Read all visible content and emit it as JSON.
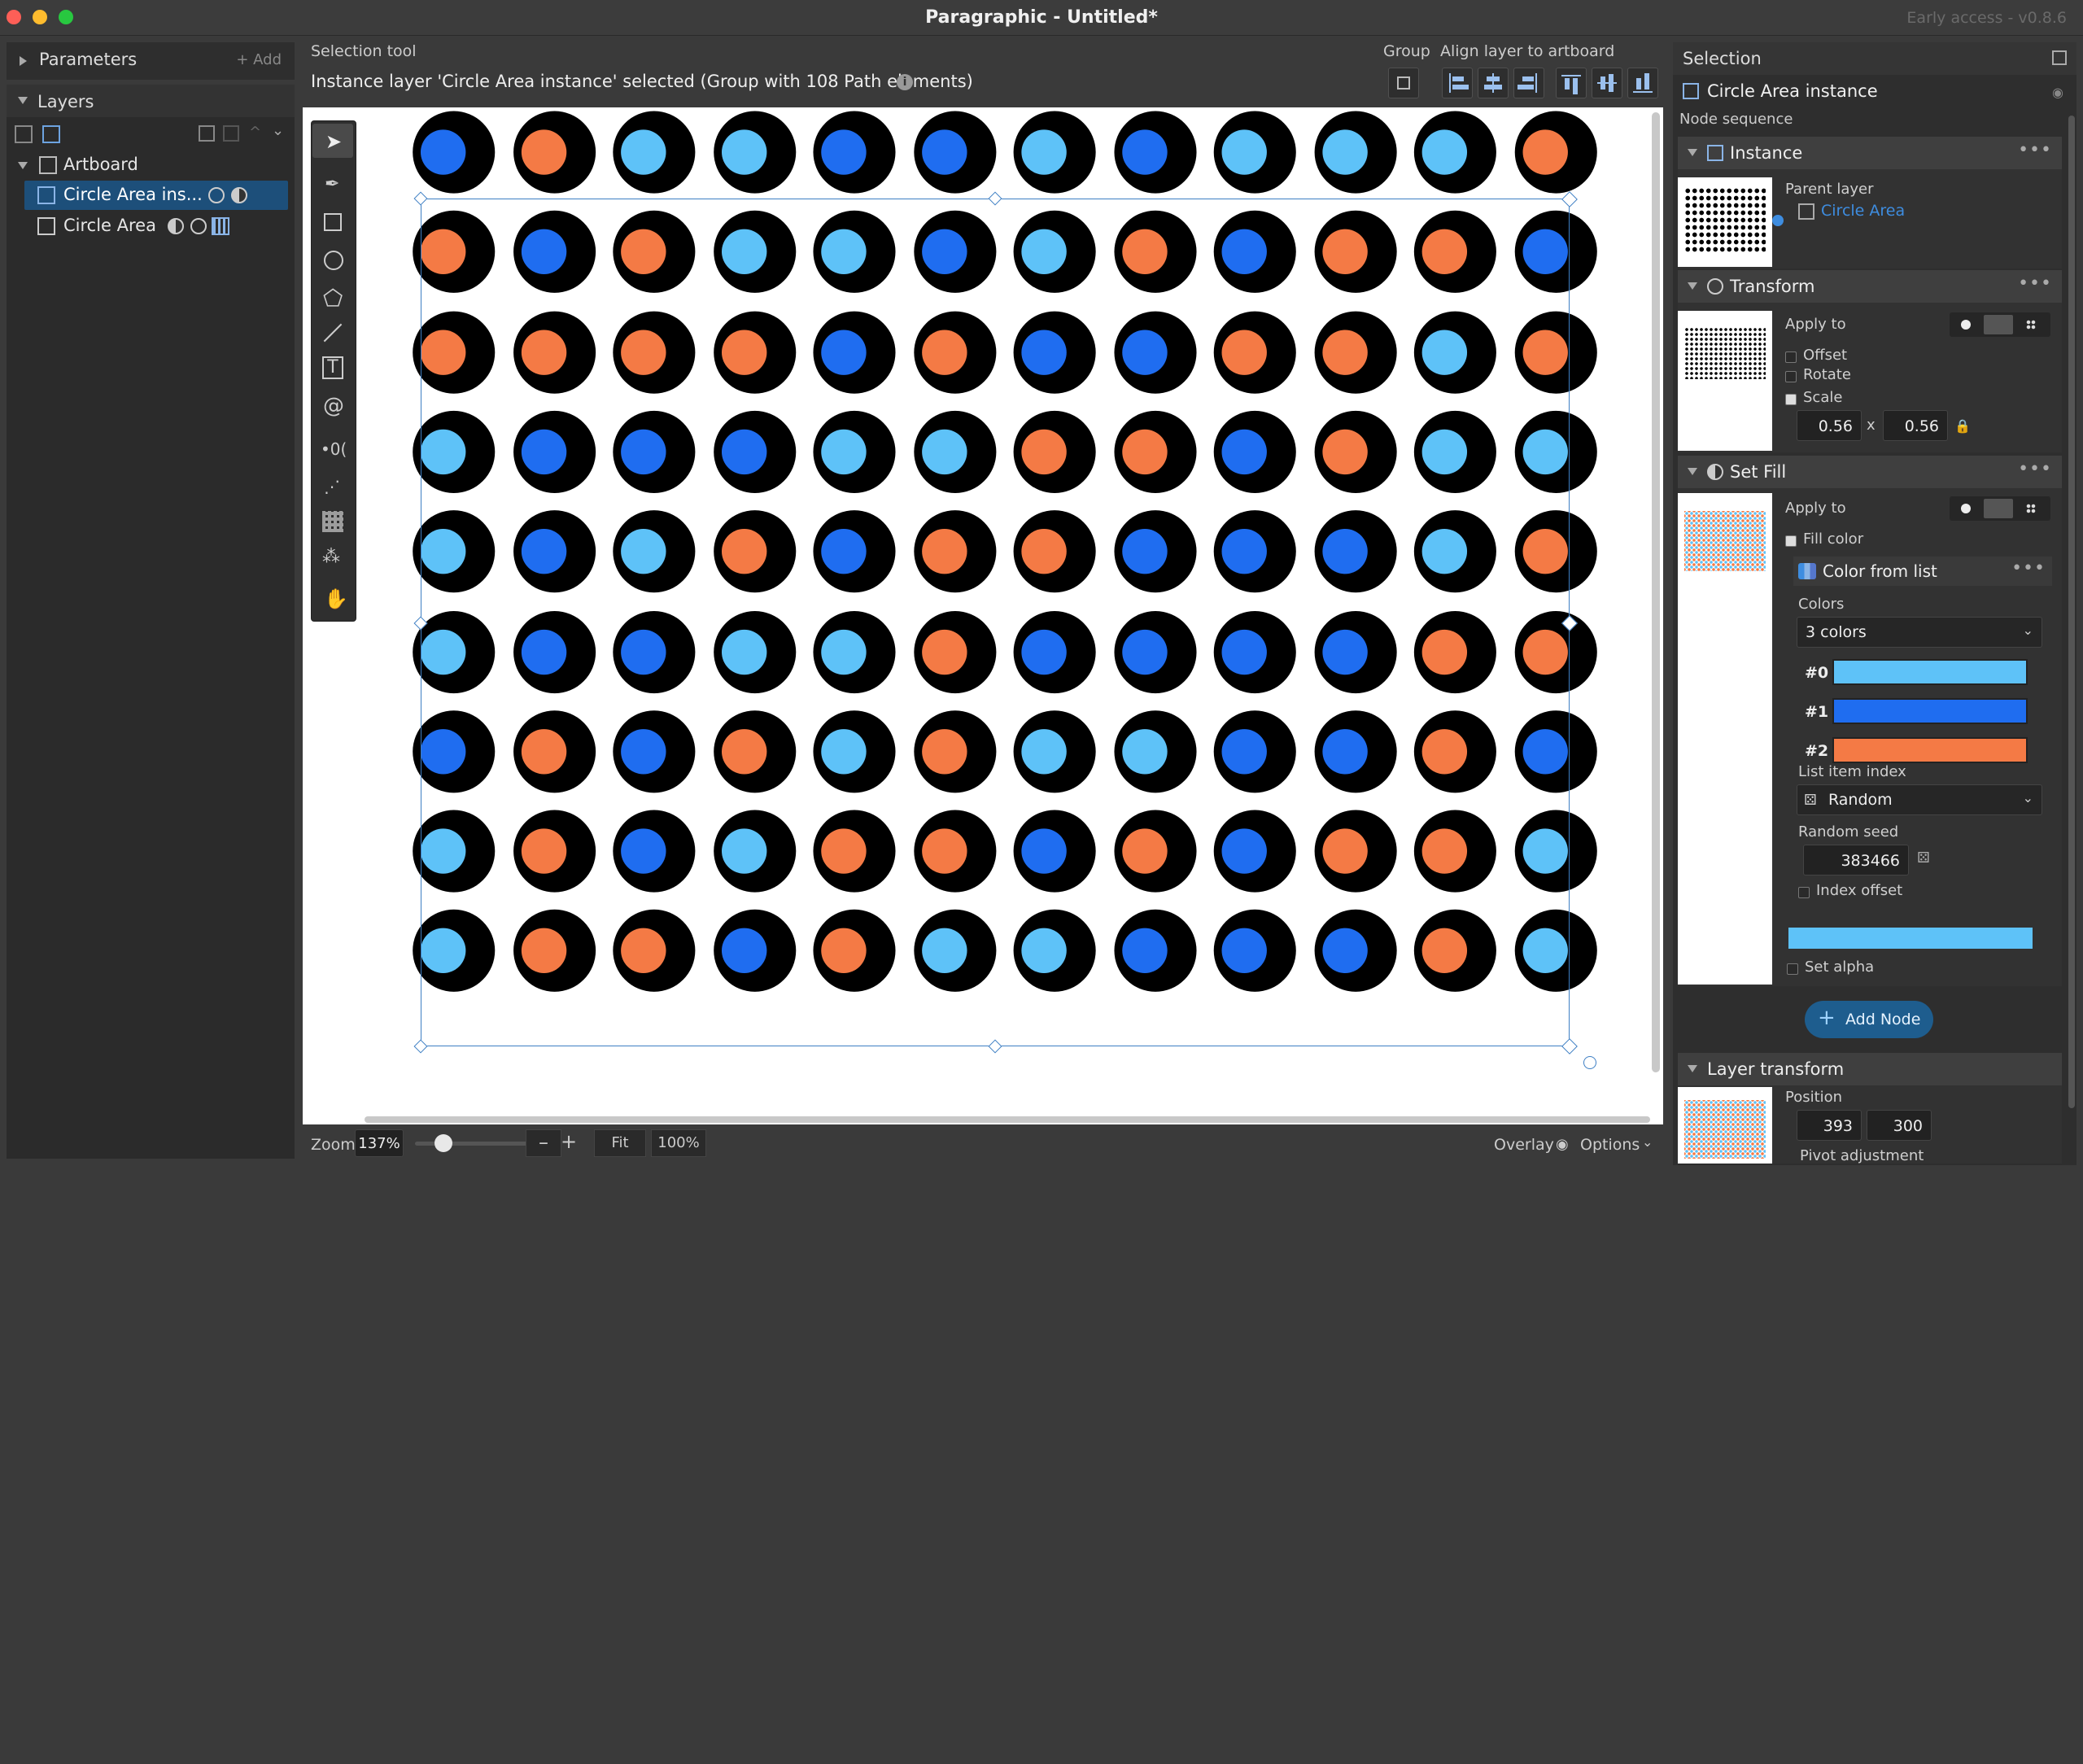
{
  "window": {
    "title": "Paragraphic - Untitled*",
    "version": "Early access - v0.8.6"
  },
  "left": {
    "parameters": {
      "label": "Parameters",
      "add": "+ Add"
    },
    "layers": {
      "label": "Layers",
      "items": [
        {
          "label": "Artboard"
        },
        {
          "label": "Circle Area ins..."
        },
        {
          "label": "Circle Area"
        }
      ]
    }
  },
  "header": {
    "tool": "Selection tool",
    "info": "Instance layer 'Circle Area instance' selected (Group with 108 Path elements)",
    "group_label": "Group",
    "align_label": "Align layer to artboard"
  },
  "canvas": {
    "grid_rows": 9,
    "grid_cols": 12,
    "colors": [
      "#5ec2f8",
      "#1f6df0",
      "#f47a45"
    ],
    "cells": [
      [
        1,
        2,
        0,
        0,
        1,
        1,
        0,
        1,
        0,
        0,
        0,
        2
      ],
      [
        2,
        1,
        2,
        0,
        0,
        1,
        0,
        2,
        1,
        2,
        2,
        1
      ],
      [
        2,
        2,
        2,
        2,
        1,
        2,
        1,
        1,
        2,
        2,
        0,
        2
      ],
      [
        0,
        1,
        1,
        1,
        0,
        0,
        2,
        2,
        1,
        2,
        0,
        0
      ],
      [
        0,
        1,
        0,
        2,
        1,
        2,
        2,
        1,
        1,
        1,
        0,
        2
      ],
      [
        0,
        1,
        1,
        0,
        0,
        2,
        1,
        1,
        1,
        1,
        2,
        2
      ],
      [
        1,
        2,
        1,
        2,
        0,
        2,
        0,
        0,
        1,
        1,
        2,
        1
      ],
      [
        0,
        2,
        1,
        0,
        2,
        2,
        1,
        2,
        1,
        2,
        2,
        0
      ],
      [
        0,
        2,
        2,
        1,
        2,
        0,
        0,
        1,
        1,
        1,
        2,
        0
      ]
    ]
  },
  "status": {
    "zoom_label": "Zoom",
    "zoom_value": "137%",
    "zoom_slider": 0.25,
    "minus": "–",
    "plus": "+",
    "fit": "Fit",
    "pct100": "100%",
    "overlay": "Overlay",
    "options": "Options"
  },
  "right": {
    "selection": "Selection",
    "layer_name": "Circle Area instance",
    "node_sequence": "Node sequence",
    "instance": {
      "title": "Instance",
      "parent_label": "Parent layer",
      "parent_value": "Circle Area"
    },
    "transform": {
      "title": "Transform",
      "apply_to": "Apply to",
      "offset": "Offset",
      "rotate": "Rotate",
      "scale": "Scale",
      "scale_x": "0.56",
      "x_sep": "x",
      "scale_y": "0.56"
    },
    "set_fill": {
      "title": "Set Fill",
      "apply_to": "Apply to",
      "fill_color": "Fill color",
      "color_from_list": "Color from list",
      "colors_label": "Colors",
      "colors_value": "3 colors",
      "swatches": [
        {
          "label": "#0",
          "color": "#5ec2f8"
        },
        {
          "label": "#1",
          "color": "#1f6df0"
        },
        {
          "label": "#2",
          "color": "#f47a45"
        }
      ],
      "list_item_index": "List item index",
      "index_mode": "Random",
      "random_seed_label": "Random seed",
      "random_seed": "383466",
      "index_offset": "Index offset",
      "preview_color": "#5ec2f8",
      "set_alpha": "Set alpha"
    },
    "add_node": "Add Node",
    "layer_transform": {
      "title": "Layer transform",
      "position": "Position",
      "x": "393",
      "y": "300",
      "pivot": "Pivot adjustment"
    }
  }
}
